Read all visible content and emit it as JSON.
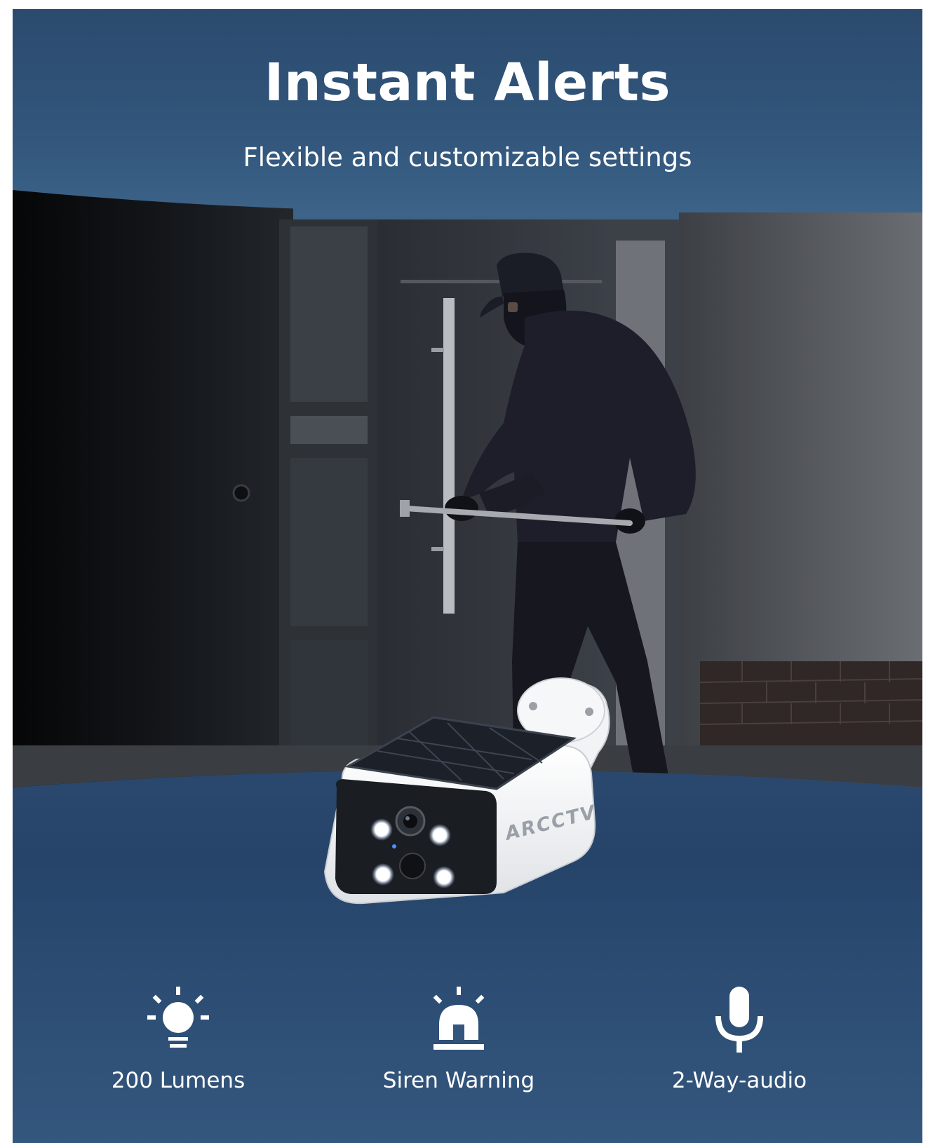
{
  "header": {
    "title": "Instant Alerts",
    "subtitle": "Flexible and customizable settings"
  },
  "product": {
    "brand_mark": "ARCCTV"
  },
  "features": [
    {
      "icon": "light-bulb-icon",
      "label": "200 Lumens"
    },
    {
      "icon": "siren-icon",
      "label": "Siren Warning"
    },
    {
      "icon": "microphone-icon",
      "label": "2-Way-audio"
    }
  ],
  "colors": {
    "background": "#2f4d72",
    "text": "#ffffff"
  }
}
